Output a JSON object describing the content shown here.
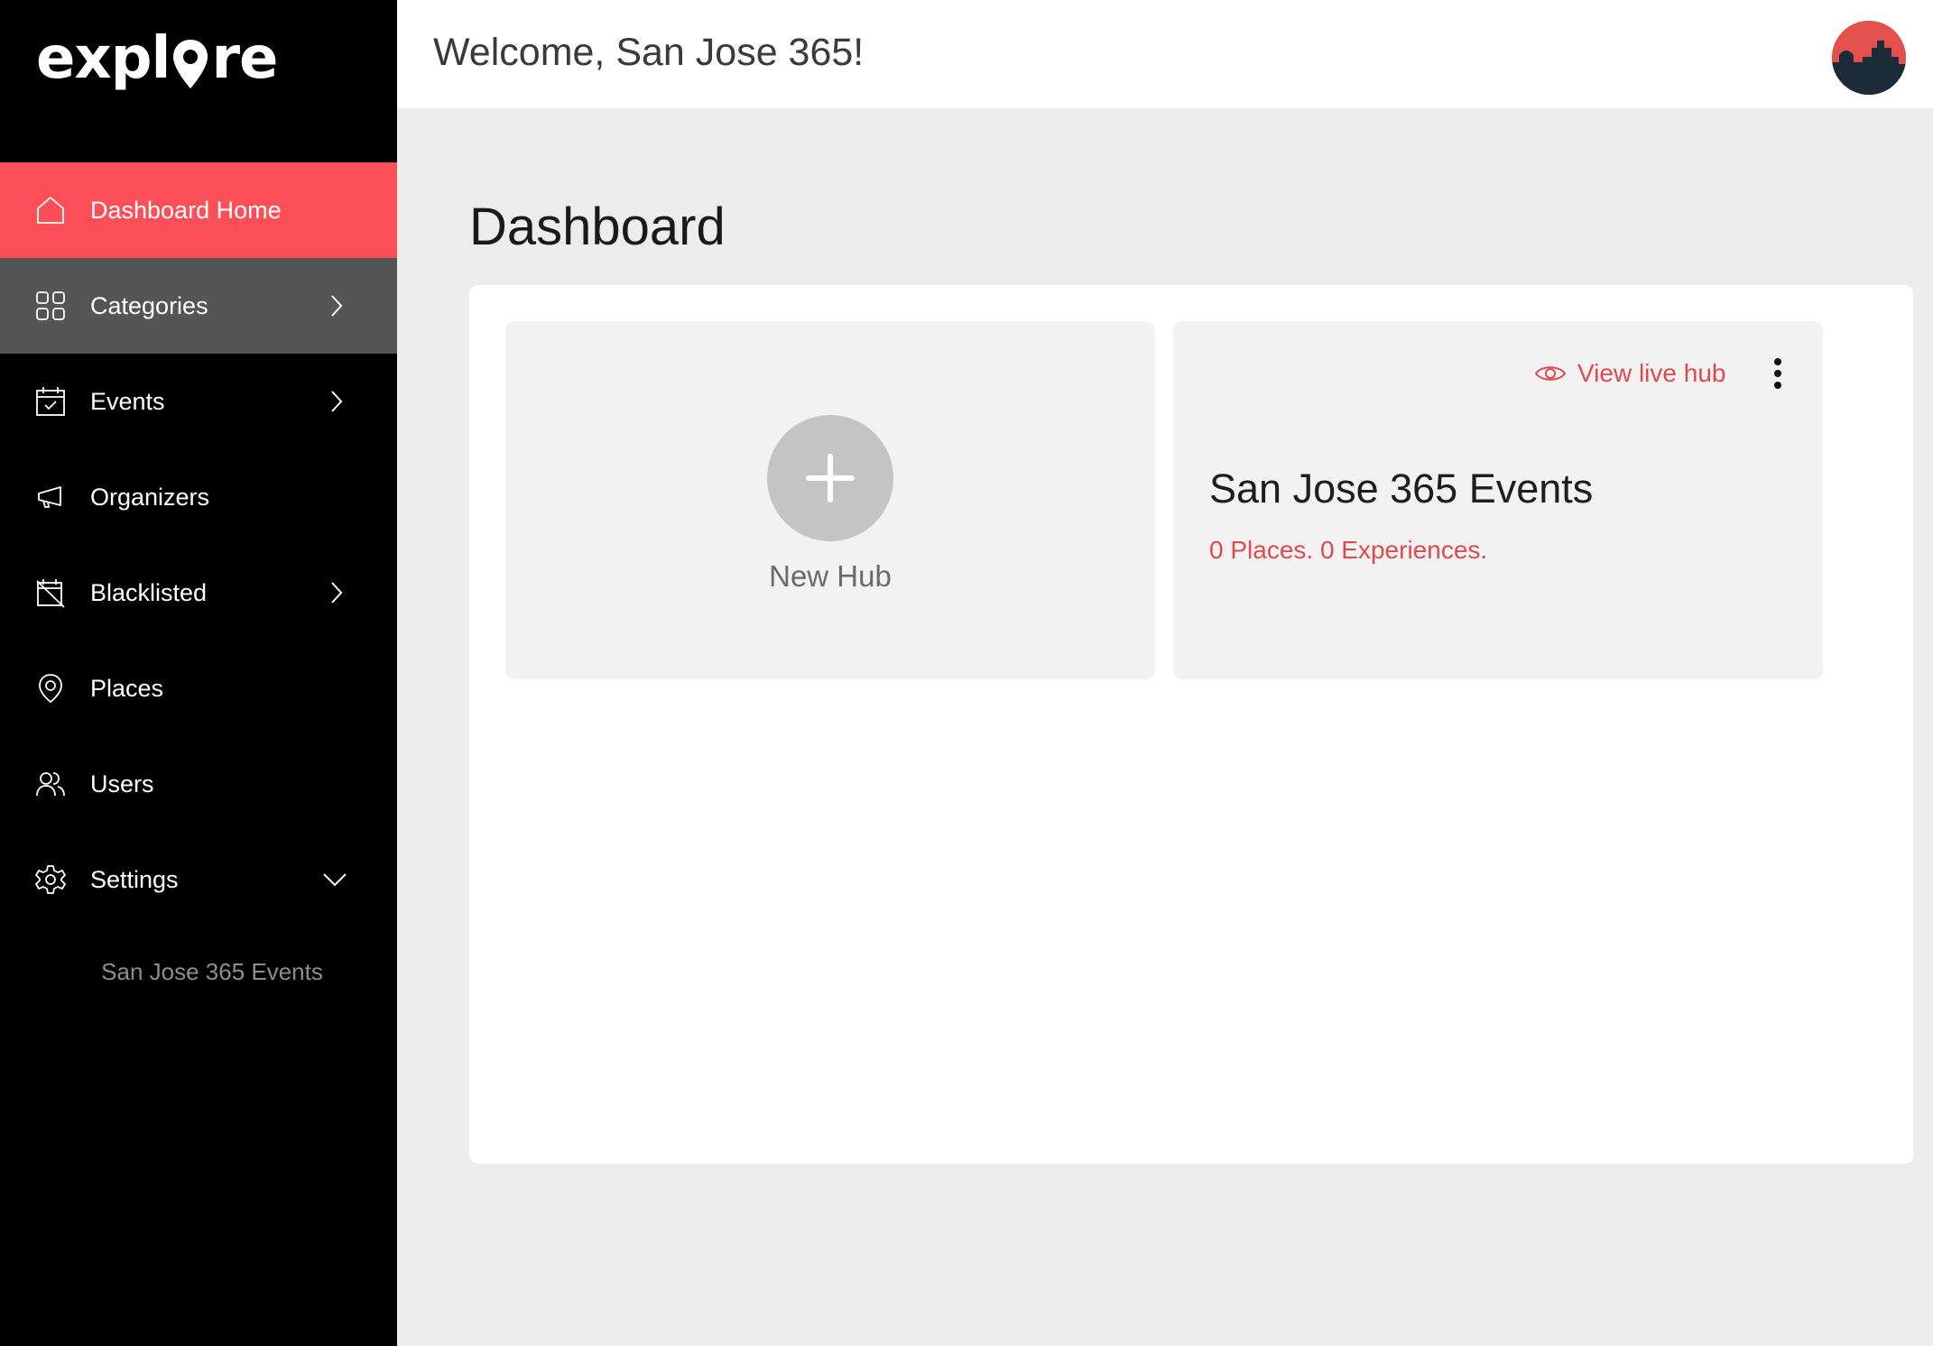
{
  "app": {
    "logo_text_left": "expl",
    "logo_text_right": "re"
  },
  "header": {
    "welcome": "Welcome, San Jose 365!"
  },
  "sidebar": {
    "items": [
      {
        "label": "Dashboard Home",
        "icon": "home-icon",
        "state": "active"
      },
      {
        "label": "Categories",
        "icon": "grid-icon",
        "state": "hover",
        "chevron": "right"
      },
      {
        "label": "Events",
        "icon": "calendar-check-icon",
        "chevron": "right"
      },
      {
        "label": "Organizers",
        "icon": "megaphone-icon"
      },
      {
        "label": "Blacklisted",
        "icon": "calendar-blocked-icon",
        "chevron": "right"
      },
      {
        "label": "Places",
        "icon": "location-pin-icon"
      },
      {
        "label": "Users",
        "icon": "users-icon"
      },
      {
        "label": "Settings",
        "icon": "gear-icon",
        "chevron": "down"
      }
    ],
    "settings_sub": "San Jose 365 Events"
  },
  "main": {
    "title": "Dashboard",
    "new_hub_label": "New Hub",
    "hub": {
      "view_live": "View live hub",
      "name": "San Jose 365 Events",
      "stats": "0 Places. 0 Experiences."
    }
  },
  "colors": {
    "accent": "#fc4f57",
    "accent_text": "#e04a4f",
    "sidebar_bg": "#000000",
    "hover_bg": "#555555"
  }
}
